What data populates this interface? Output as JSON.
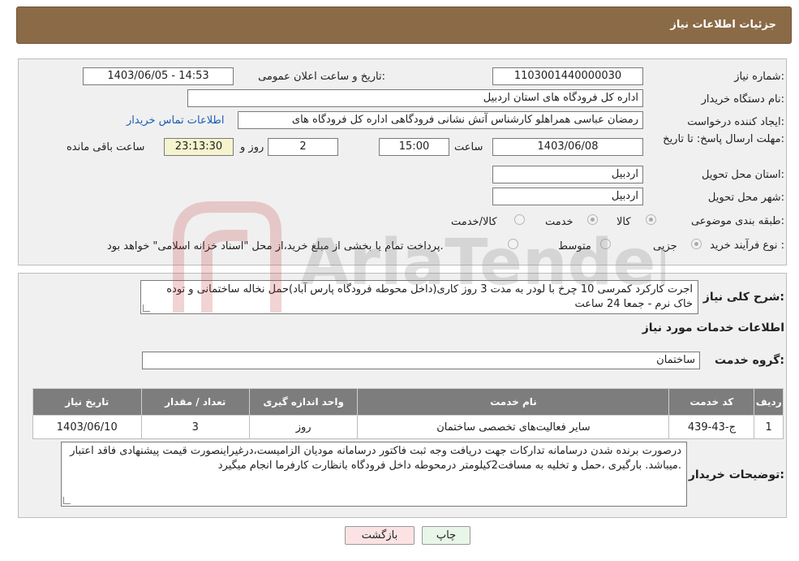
{
  "header": {
    "title": "جزئیات اطلاعات نیاز"
  },
  "form": {
    "need_number_label": "شماره نیاز:",
    "need_number": "1103001440000030",
    "announce_label": "تاریخ و ساعت اعلان عمومی:",
    "announce_value": "1403/06/05 - 14:53",
    "buyer_org_label": "نام دستگاه خریدار:",
    "buyer_org": "اداره کل فرودگاه های استان اردبیل",
    "creator_label": "ایجاد کننده درخواست:",
    "creator": "رمضان عباسی همراهلو  کارشناس آتش نشانی فرودگاهی اداره کل فرودگاه های",
    "contact_link": "اطلاعات تماس خریدار",
    "deadline_label": "مهلت ارسال پاسخ: تا تاریخ:",
    "deadline_date": "1403/06/08",
    "time_label": "ساعت",
    "deadline_time": "15:00",
    "days_value": "2",
    "days_label": "روز و",
    "remaining_time": "23:13:30",
    "remaining_label": "ساعت باقی مانده",
    "province_label": "استان محل تحویل:",
    "province": "اردبیل",
    "city_label": "شهر محل تحویل:",
    "city": "اردبیل",
    "category_label": "طبقه بندی موضوعی:",
    "category_options": [
      "کالا",
      "خدمت",
      "کالا/خدمت"
    ],
    "process_label": "نوع فرآیند خرید :",
    "process_options": [
      "جزیی",
      "متوسط"
    ],
    "payment_note": "پرداخت تمام یا بخشی از مبلغ خرید،از محل \"اسناد خزانه اسلامی\" خواهد بود."
  },
  "summary": {
    "label": "شرح کلی نیاز:",
    "text": "اجرت کارکرد کمرسی 10 چرخ با لودر به مدت 3 روز کاری(داخل محوطه فرودگاه  پارس آباد)حمل نخاله ساختمانی و توده خاک نرم - جمعا 24 ساعت"
  },
  "services": {
    "title": "اطلاعات خدمات مورد نیاز",
    "group_label": "گروه خدمت:",
    "group_value": "ساختمان",
    "columns": [
      "ردیف",
      "کد خدمت",
      "نام خدمت",
      "واحد اندازه گیری",
      "تعداد / مقدار",
      "تاریخ نیاز"
    ],
    "rows": [
      [
        "1",
        "ج-43-439",
        "سایر فعالیت‌های تخصصی ساختمان",
        "روز",
        "3",
        "1403/06/10"
      ]
    ]
  },
  "notes": {
    "label": "توضیحات خریدار:",
    "text": "درصورت برنده شدن درسامانه تدارکات جهت دریافت وجه ثبت فاکتور درسامانه مودیان الزامیست،درغیراینصورت قیمت پیشنهادی فاقد اعتبار میباشد. بارگیری ،حمل و تخلیه به مسافت2کیلومتر درمحوطه داخل فرودگاه بانظارت کارفرما انجام میگیرد."
  },
  "buttons": {
    "print": "چاپ",
    "back": "بازگشت"
  },
  "watermark": {
    "text": "AriaTender.neT"
  },
  "colors": {
    "header_bg": "#8b6a47",
    "panel_bg": "#f0f0f0",
    "table_header_bg": "#7d7d7d",
    "print_bg": "#e8f6e8",
    "back_bg": "#fbe3e3",
    "link": "#1a5db5"
  }
}
